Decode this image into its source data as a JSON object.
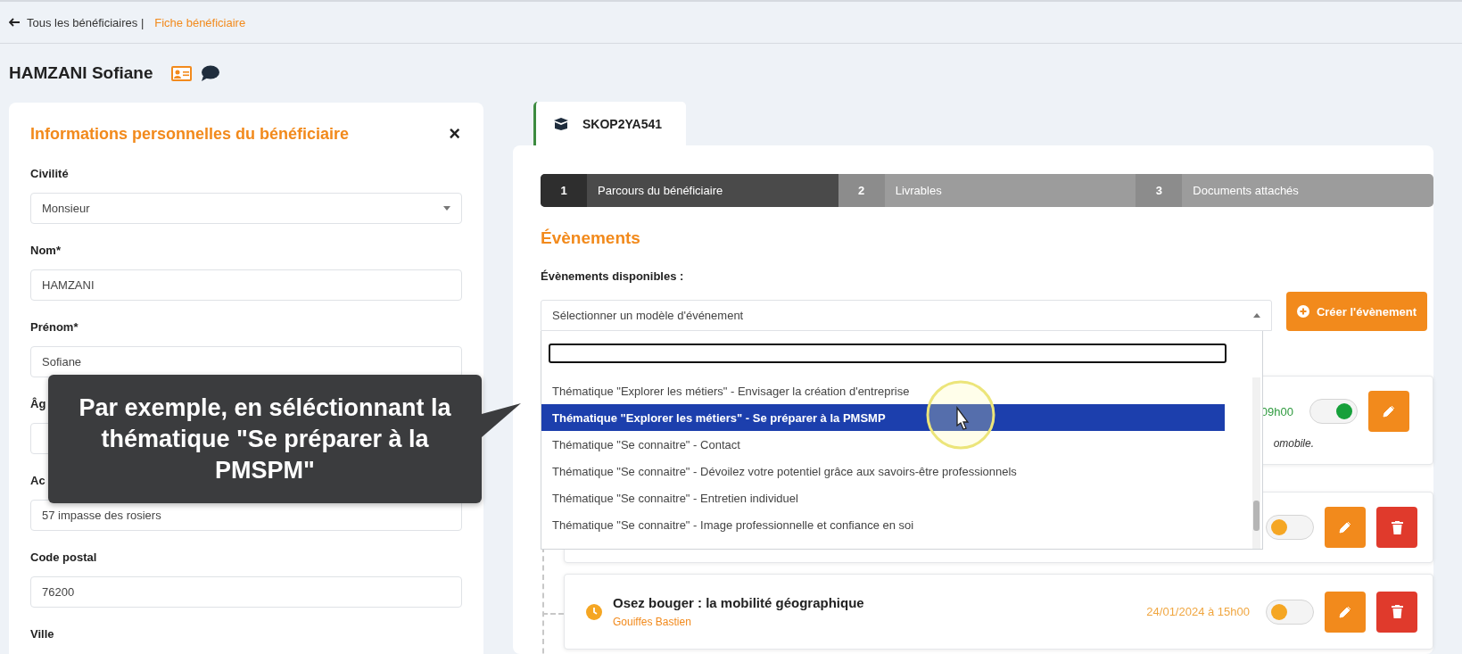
{
  "breadcrumb": {
    "back": "Tous les bénéficiaires |",
    "current": "Fiche bénéficiaire"
  },
  "beneficiary": {
    "name": "HAMZANI Sofiane"
  },
  "personal_info": {
    "title": "Informations personnelles du bénéficiaire",
    "close": "×",
    "fields": [
      {
        "label": "Civilité",
        "kind": "select",
        "value": "Monsieur"
      },
      {
        "label": "Nom*",
        "kind": "input",
        "value": "HAMZANI"
      },
      {
        "label": "Prénom*",
        "kind": "input",
        "value": "Sofiane"
      },
      {
        "label": "Âg",
        "kind": "input"
      },
      {
        "label": "Ac",
        "kind": "input",
        "value": "57 impasse des rosiers"
      },
      {
        "label": "Code postal",
        "kind": "input",
        "value": "76200"
      },
      {
        "label": "Ville",
        "kind": "label"
      }
    ]
  },
  "callout": {
    "text": "Par exemple, en séléctionnant la thématique \"Se préparer à la PMSPM\""
  },
  "dossier_tab": {
    "label": "SKOP2YA541"
  },
  "steps": [
    {
      "number": "1",
      "label": "Parcours du bénéficiaire",
      "selected": true
    },
    {
      "number": "2",
      "label": "Livrables",
      "selected": false
    },
    {
      "number": "3",
      "label": "Documents attachés",
      "selected": false
    }
  ],
  "events": {
    "title": "Évènements",
    "available_label": "Évènements disponibles :",
    "select_placeholder": "Sélectionner un modèle d'événement",
    "create_button": "Créer l'évènement",
    "dropdown": {
      "options": [
        {
          "label": "Thématique \"Explorer les métiers\" - Envisager la création d'entreprise",
          "selected": false
        },
        {
          "label": "Thématique \"Explorer les métiers\" - Se préparer à la PMSMP",
          "selected": true
        },
        {
          "label": "Thématique \"Se connaitre\" - Contact",
          "selected": false
        },
        {
          "label": "Thématique \"Se connaitre\" - Dévoilez votre potentiel grâce aux savoirs-être professionnels",
          "selected": false
        },
        {
          "label": "Thématique \"Se connaitre\" - Entretien individuel",
          "selected": false
        },
        {
          "label": "Thématique \"Se connaitre\" - Image professionnelle et confiance en soi",
          "selected": false
        }
      ]
    },
    "items": [
      {
        "date": "09h00",
        "note": "omobile.",
        "on": true,
        "deletable": false
      },
      {
        "on": false,
        "deletable": true
      },
      {
        "title": "Osez bouger : la mobilité géographique",
        "author": "Gouiffes Bastien",
        "date": "24/01/2024 à 15h00",
        "on": false,
        "deletable": true
      }
    ]
  }
}
